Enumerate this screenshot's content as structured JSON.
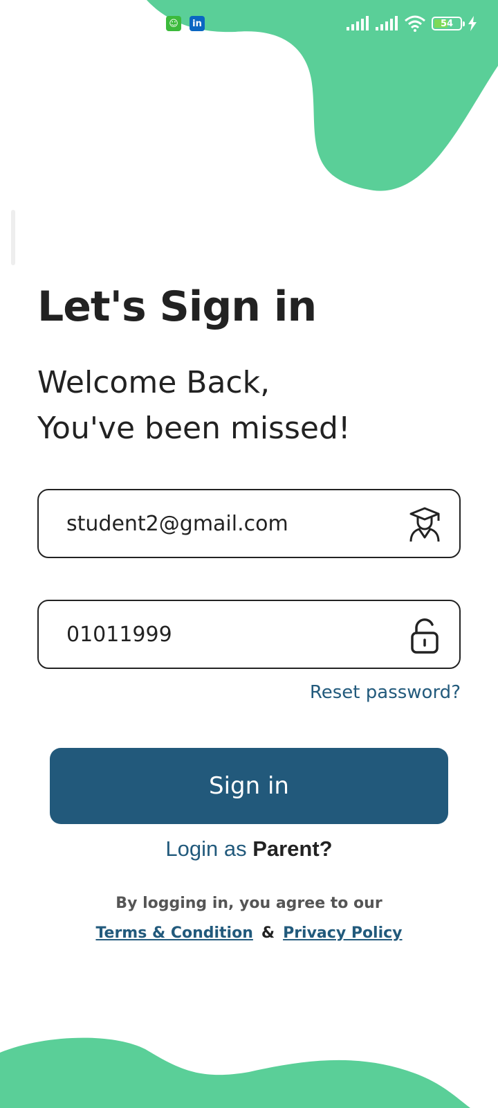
{
  "colors": {
    "accent_green": "#5acf98",
    "primary_blue": "#22597b",
    "text_dark": "#222222"
  },
  "status_bar": {
    "notification_icons": [
      "app-icon",
      "linkedin-icon"
    ],
    "linkedin_label": "in",
    "battery_level": "54",
    "battery_percent": 54,
    "signal_bars": 2,
    "wifi": true,
    "charging": true
  },
  "header": {
    "title": "Let's Sign in",
    "welcome_line1": "Welcome Back,",
    "welcome_line2": "You've been missed!"
  },
  "form": {
    "email_value": "student2@gmail.com",
    "email_icon": "student-graduate-icon",
    "password_value": "01011999",
    "password_icon": "unlock-icon",
    "reset_label": "Reset password?",
    "signin_label": "Sign in"
  },
  "login_as": {
    "prefix": "Login as",
    "role": "Parent?"
  },
  "legal": {
    "agree_text": "By logging in, you agree to our",
    "terms_label": "Terms & Condition",
    "separator": "&",
    "privacy_label": "Privacy Policy"
  }
}
